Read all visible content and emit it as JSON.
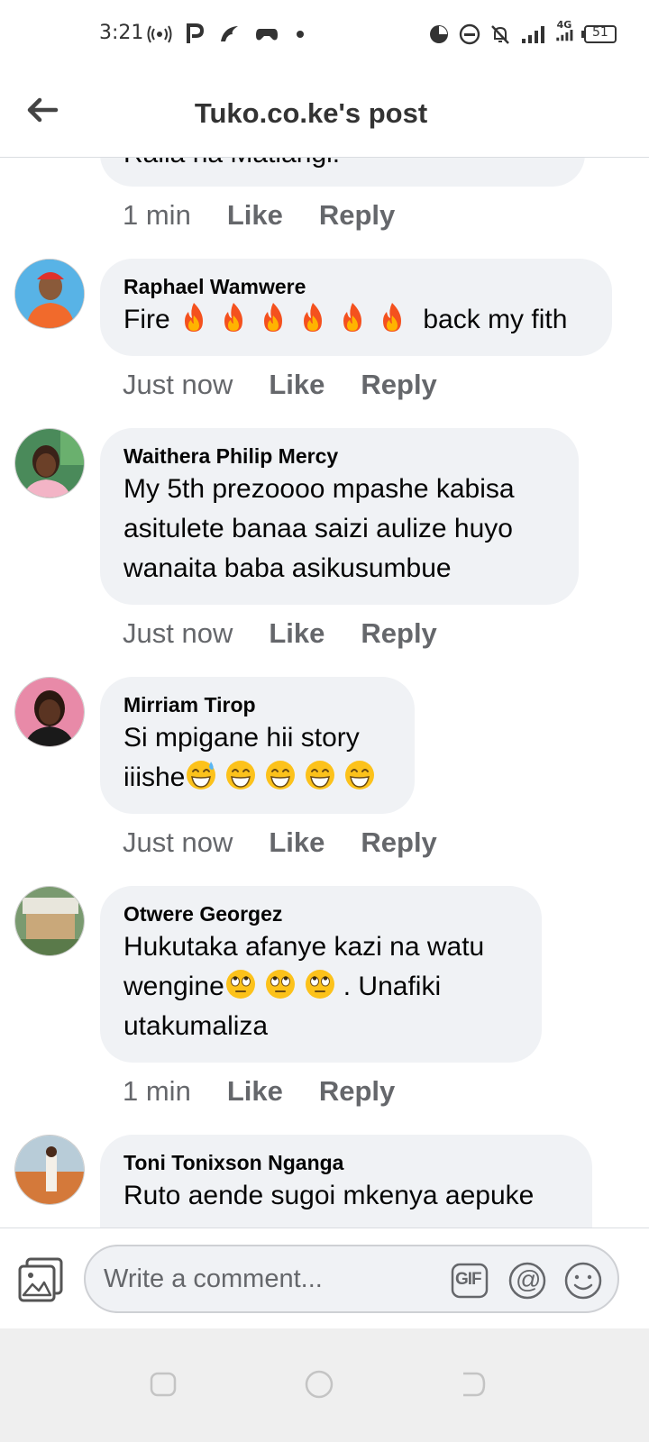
{
  "status_bar": {
    "time": "3:21",
    "network_badge": "4G",
    "battery": "51"
  },
  "header": {
    "title": "Tuko.co.ke's post"
  },
  "previous_comment": {
    "text_fragment": "Raila na Matiangi.",
    "time": "1 min",
    "like_label": "Like",
    "reply_label": "Reply"
  },
  "comments": [
    {
      "author": "Raphael Wamwere",
      "text_before": "Fire",
      "emojis": [
        "fire",
        "fire",
        "fire",
        "fire",
        "fire",
        "fire"
      ],
      "text_after": "back my fith",
      "time": "Just now",
      "like_label": "Like",
      "reply_label": "Reply"
    },
    {
      "author": "Waithera Philip Mercy",
      "lines": [
        "My 5th prezoooo mpashe kabisa",
        "asitulete banaa saizi aulize huyo",
        "wanaita baba asikusumbue"
      ],
      "time": "Just now",
      "like_label": "Like",
      "reply_label": "Reply"
    },
    {
      "author": "Mirriam Tirop",
      "line1": "Si mpigane hii story",
      "line2_text": "iiishe",
      "line2_emojis": [
        "grinning-sweat",
        "grinning",
        "grinning",
        "grinning",
        "grinning"
      ],
      "time": "Just now",
      "like_label": "Like",
      "reply_label": "Reply"
    },
    {
      "author": "Otwere Georgez",
      "line1": "Hukutaka afanye kazi na watu",
      "line2_text": "wengine",
      "line2_emojis": [
        "eye-roll",
        "eye-roll",
        "eye-roll"
      ],
      "line2_after": ". Unafiki",
      "line3": "utakumaliza",
      "time": "1 min",
      "like_label": "Like",
      "reply_label": "Reply"
    },
    {
      "author": "Toni Tonixson Nganga",
      "line1": "Ruto aende sugoi mkenya aepuke"
    }
  ],
  "composer": {
    "placeholder": "Write a comment...",
    "gif_label": "GIF",
    "mention_label": "@"
  },
  "colors": {
    "bubble": "#f0f2f5",
    "secondary_text": "#65676b",
    "primary_text": "#050505"
  }
}
